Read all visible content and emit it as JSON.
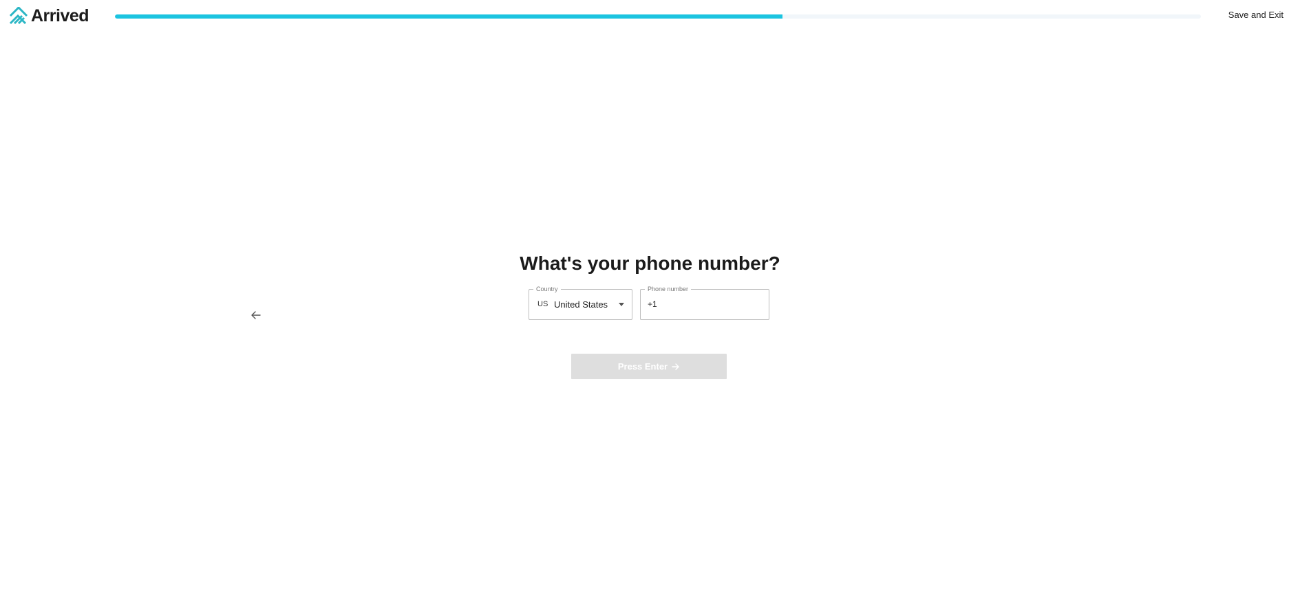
{
  "header": {
    "brand": "Arrived",
    "save_exit_label": "Save and Exit",
    "progress_fraction": 0.615,
    "progress_color": "#1cc4e0",
    "brand_color": "#2bb6c5"
  },
  "form": {
    "question": "What's your phone number?",
    "country": {
      "label": "Country",
      "code": "US",
      "name": "United States"
    },
    "phone": {
      "label": "Phone number",
      "value": "+1"
    },
    "submit_label": "Press Enter"
  },
  "icons": {
    "logo": "arrived-logo-icon",
    "back": "arrow-left-icon",
    "dropdown": "chevron-down-icon",
    "submit": "arrow-right-icon"
  }
}
